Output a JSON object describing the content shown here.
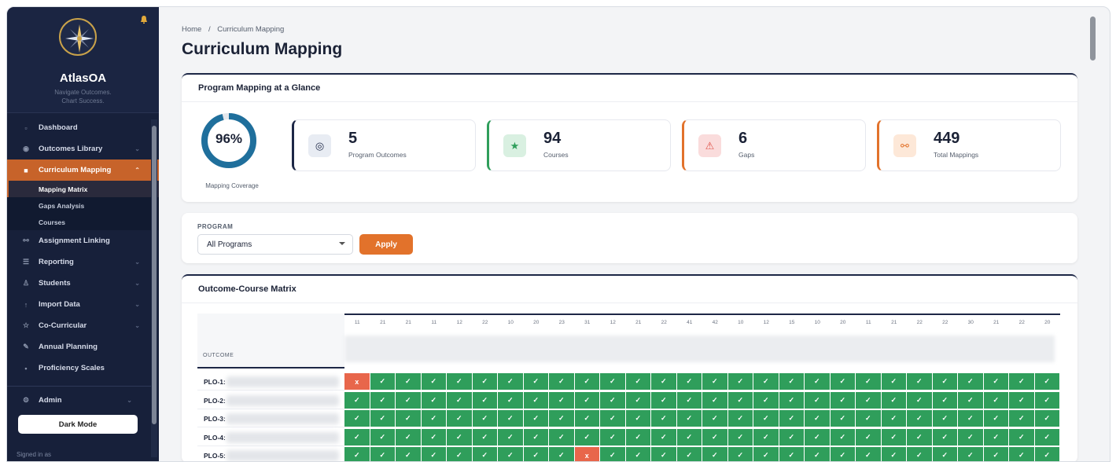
{
  "app": {
    "name": "AtlasOA",
    "tagline_line1": "Navigate Outcomes.",
    "tagline_line2": "Chart Success."
  },
  "sidebar": {
    "items": [
      {
        "label": "Dashboard",
        "icon": "dashboard-icon"
      },
      {
        "label": "Outcomes Library",
        "icon": "target-icon"
      },
      {
        "label": "Curriculum Mapping",
        "icon": "map-icon"
      },
      {
        "label": "Assignment Linking",
        "icon": "link-icon"
      },
      {
        "label": "Reporting",
        "icon": "list-icon"
      },
      {
        "label": "Students",
        "icon": "user-icon"
      },
      {
        "label": "Import Data",
        "icon": "upload-icon"
      },
      {
        "label": "Co-Curricular",
        "icon": "star-icon"
      },
      {
        "label": "Annual Planning",
        "icon": "pencil-icon"
      },
      {
        "label": "Proficiency Scales",
        "icon": "dot-icon"
      },
      {
        "label": "Admin",
        "icon": "gear-icon"
      }
    ],
    "subitems": [
      {
        "label": "Mapping Matrix"
      },
      {
        "label": "Gaps Analysis"
      },
      {
        "label": "Courses"
      }
    ],
    "dark_mode_label": "Dark Mode",
    "signed_in_label": "Signed in as"
  },
  "breadcrumb": {
    "home": "Home",
    "separator": "/",
    "current": "Curriculum Mapping"
  },
  "page_title": "Curriculum Mapping",
  "glance": {
    "title": "Program Mapping at a Glance",
    "coverage_value": "96%",
    "coverage_fraction": 0.96,
    "coverage_label": "Mapping Coverage",
    "stats": [
      {
        "value": "5",
        "label": "Program Outcomes",
        "color": "#1d2746",
        "icon": "target-icon"
      },
      {
        "value": "94",
        "label": "Courses",
        "color": "#2f9e5b",
        "icon": "star-icon"
      },
      {
        "value": "6",
        "label": "Gaps",
        "color": "#e2722b",
        "icon": "warning-icon"
      },
      {
        "value": "449",
        "label": "Total Mappings",
        "color": "#e2722b",
        "icon": "link-icon"
      }
    ]
  },
  "filter": {
    "label": "PROGRAM",
    "selected": "All Programs",
    "apply_label": "Apply"
  },
  "matrix": {
    "title": "Outcome-Course Matrix",
    "outcome_header": "OUTCOME",
    "columns": [
      "11",
      "21",
      "21",
      "11",
      "12",
      "22",
      "10",
      "20",
      "23",
      "31",
      "12",
      "21",
      "22",
      "41",
      "42",
      "10",
      "12",
      "15",
      "10",
      "20",
      "11",
      "21",
      "22",
      "22",
      "30",
      "21",
      "22",
      "20"
    ],
    "rows": [
      {
        "label": "PLO-1:",
        "gaps": [
          0
        ]
      },
      {
        "label": "PLO-2:",
        "gaps": []
      },
      {
        "label": "PLO-3:",
        "gaps": []
      },
      {
        "label": "PLO-4:",
        "gaps": []
      },
      {
        "label": "PLO-5:",
        "gaps": [
          9
        ]
      }
    ],
    "mapped_mark": "✓",
    "gap_mark": "x"
  },
  "colors": {
    "accent": "#e2722b",
    "navy": "#1d2746",
    "mapped": "#2f9e5b",
    "gap": "#e8664b"
  }
}
